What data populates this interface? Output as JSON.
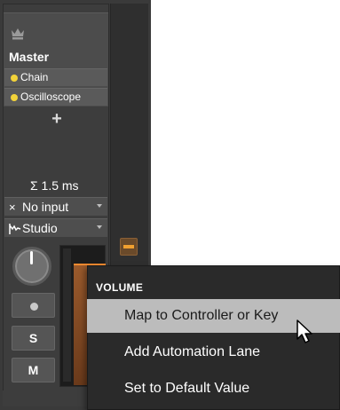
{
  "channel": {
    "name": "Master",
    "devices": [
      {
        "label": "Chain"
      },
      {
        "label": "Oscilloscope"
      }
    ],
    "add_device_symbol": "+",
    "latency": "Σ 1.5 ms",
    "input": {
      "label": "No input",
      "icon": "×"
    },
    "output": {
      "label": "Studio"
    },
    "buttons": {
      "solo": "S",
      "mute": "M"
    },
    "meter_level_fraction": 0.85
  },
  "context_menu": {
    "header": "VOLUME",
    "items": [
      {
        "label": "Map to Controller or Key",
        "highlighted": true
      },
      {
        "label": "Add Automation Lane",
        "highlighted": false
      },
      {
        "label": "Set to Default Value",
        "highlighted": false
      }
    ]
  },
  "colors": {
    "device_dot": "#f2d33a",
    "meter_fill": "#9a5a2c",
    "meter_level": "#f08a30",
    "menu_highlight": "#bcbcbc",
    "menu_background": "#2a2a2a"
  },
  "icons": {
    "master": "crown-icon",
    "output": "waveform-icon",
    "cursor": "mouse-pointer-icon"
  }
}
